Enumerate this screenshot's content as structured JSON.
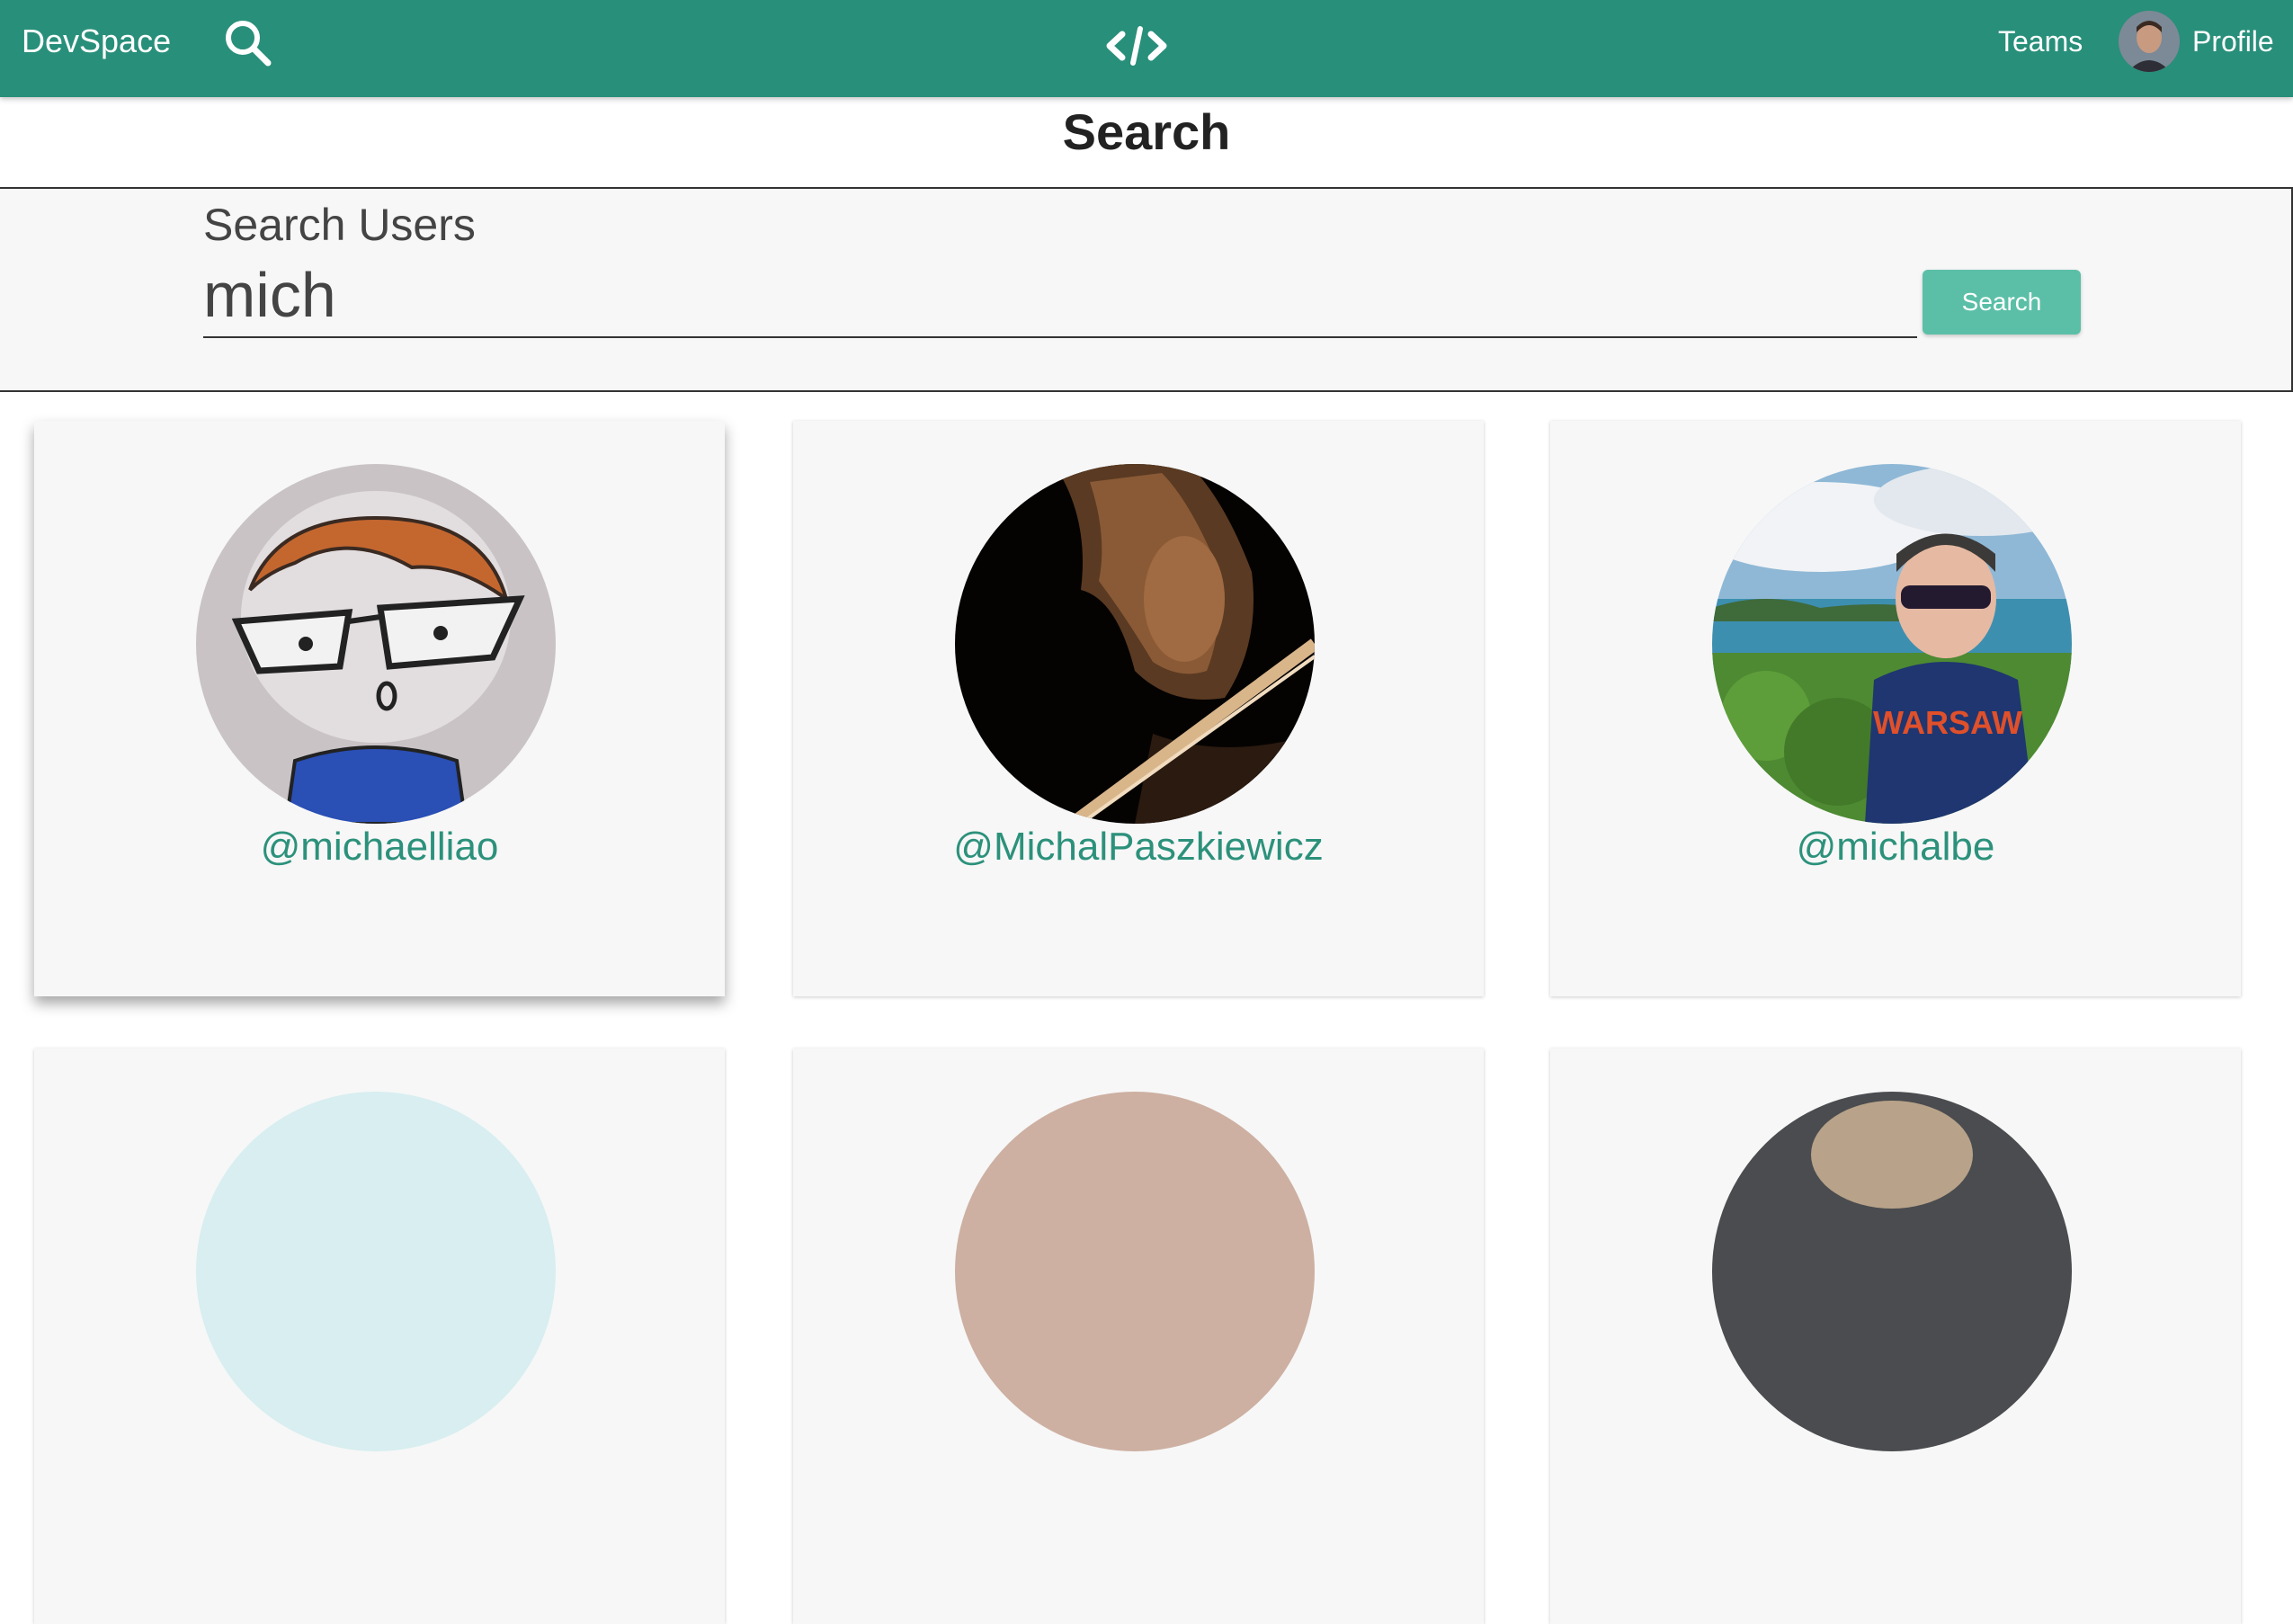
{
  "navbar": {
    "brand": "DevSpace",
    "search_icon": "search-icon",
    "logo_icon": "code-brackets-icon",
    "teams_label": "Teams",
    "profile_label": "Profile",
    "color": "#288f7a"
  },
  "page": {
    "title": "Search"
  },
  "search": {
    "label": "Search Users",
    "value": "mich",
    "button_label": "Search",
    "button_color": "#5bbfa7"
  },
  "results": [
    {
      "username": "@michaelliao",
      "avatar": "cartoon-girl-with-glasses-avatar"
    },
    {
      "username": "@MichalPaszkiewicz",
      "avatar": "violinist-photo-avatar"
    },
    {
      "username": "@michalbe",
      "avatar": "man-by-coast-photo-avatar"
    },
    {
      "username": "",
      "avatar": "partial-avatar"
    },
    {
      "username": "",
      "avatar": "partial-avatar"
    },
    {
      "username": "",
      "avatar": "partial-avatar"
    }
  ],
  "colors": {
    "username_link": "#2c917b",
    "card_background": "#f7f7f7"
  }
}
